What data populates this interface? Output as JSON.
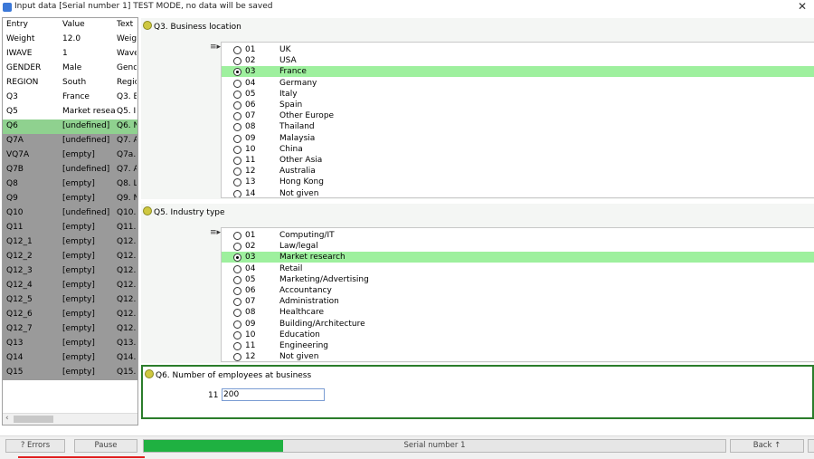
{
  "window": {
    "title": "Input data [Serial number 1] TEST MODE, no data will be saved"
  },
  "grid": {
    "headers": [
      "Entry",
      "Value",
      "Text"
    ],
    "rows": [
      {
        "entry": "Weight",
        "value": "12.0",
        "text": "Weig",
        "state": "answered"
      },
      {
        "entry": "IWAVE",
        "value": "1",
        "text": "Wave",
        "state": "answered"
      },
      {
        "entry": "GENDER",
        "value": "Male",
        "text": "Gend",
        "state": "answered"
      },
      {
        "entry": "REGION",
        "value": "South",
        "text": "Regic",
        "state": "answered"
      },
      {
        "entry": "Q3",
        "value": "France",
        "text": "Q3. B",
        "state": "answered"
      },
      {
        "entry": "Q5",
        "value": "Market resea",
        "text": "Q5. In",
        "state": "answered"
      },
      {
        "entry": "Q6",
        "value": "[undefined]",
        "text": "Q6. N",
        "state": "current"
      },
      {
        "entry": "Q7A",
        "value": "[undefined]",
        "text": "Q7. A",
        "state": "pending"
      },
      {
        "entry": "VQ7A",
        "value": "[empty]",
        "text": "Q7a.",
        "state": "pending"
      },
      {
        "entry": "Q7B",
        "value": "[undefined]",
        "text": "Q7. A",
        "state": "pending"
      },
      {
        "entry": "Q8",
        "value": "[empty]",
        "text": "Q8. L",
        "state": "pending"
      },
      {
        "entry": "Q9",
        "value": "[empty]",
        "text": "Q9. N",
        "state": "pending"
      },
      {
        "entry": "Q10",
        "value": "[undefined]",
        "text": "Q10.",
        "state": "pending"
      },
      {
        "entry": "Q11",
        "value": "[empty]",
        "text": "Q11.",
        "state": "pending"
      },
      {
        "entry": "Q12_1",
        "value": "[empty]",
        "text": "Q12.",
        "state": "pending"
      },
      {
        "entry": "Q12_2",
        "value": "[empty]",
        "text": "Q12.",
        "state": "pending"
      },
      {
        "entry": "Q12_3",
        "value": "[empty]",
        "text": "Q12.",
        "state": "pending"
      },
      {
        "entry": "Q12_4",
        "value": "[empty]",
        "text": "Q12.",
        "state": "pending"
      },
      {
        "entry": "Q12_5",
        "value": "[empty]",
        "text": "Q12.",
        "state": "pending"
      },
      {
        "entry": "Q12_6",
        "value": "[empty]",
        "text": "Q12.",
        "state": "pending"
      },
      {
        "entry": "Q12_7",
        "value": "[empty]",
        "text": "Q12.",
        "state": "pending"
      },
      {
        "entry": "Q13",
        "value": "[empty]",
        "text": "Q13.",
        "state": "pending"
      },
      {
        "entry": "Q14",
        "value": "[empty]",
        "text": "Q14.",
        "state": "pending"
      },
      {
        "entry": "Q15",
        "value": "[empty]",
        "text": "Q15.",
        "state": "pending"
      }
    ]
  },
  "q3": {
    "title": "Q3. Business location",
    "options": [
      {
        "code": "01",
        "label": "UK",
        "selected": false
      },
      {
        "code": "02",
        "label": "USA",
        "selected": false
      },
      {
        "code": "03",
        "label": "France",
        "selected": true
      },
      {
        "code": "04",
        "label": "Germany",
        "selected": false
      },
      {
        "code": "05",
        "label": "Italy",
        "selected": false
      },
      {
        "code": "06",
        "label": "Spain",
        "selected": false
      },
      {
        "code": "07",
        "label": "Other Europe",
        "selected": false
      },
      {
        "code": "08",
        "label": "Thailand",
        "selected": false
      },
      {
        "code": "09",
        "label": "Malaysia",
        "selected": false
      },
      {
        "code": "10",
        "label": "China",
        "selected": false
      },
      {
        "code": "11",
        "label": "Other Asia",
        "selected": false
      },
      {
        "code": "12",
        "label": "Australia",
        "selected": false
      },
      {
        "code": "13",
        "label": "Hong Kong",
        "selected": false
      },
      {
        "code": "14",
        "label": "Not given",
        "selected": false
      }
    ]
  },
  "q5": {
    "title": "Q5. Industry type",
    "options": [
      {
        "code": "01",
        "label": "Computing/IT",
        "selected": false
      },
      {
        "code": "02",
        "label": "Law/legal",
        "selected": false
      },
      {
        "code": "03",
        "label": "Market research",
        "selected": true
      },
      {
        "code": "04",
        "label": "Retail",
        "selected": false
      },
      {
        "code": "05",
        "label": "Marketing/Advertising",
        "selected": false
      },
      {
        "code": "06",
        "label": "Accountancy",
        "selected": false
      },
      {
        "code": "07",
        "label": "Administration",
        "selected": false
      },
      {
        "code": "08",
        "label": "Healthcare",
        "selected": false
      },
      {
        "code": "09",
        "label": "Building/Architecture",
        "selected": false
      },
      {
        "code": "10",
        "label": "Education",
        "selected": false
      },
      {
        "code": "11",
        "label": "Engineering",
        "selected": false
      },
      {
        "code": "12",
        "label": "Not given",
        "selected": false
      }
    ]
  },
  "q6": {
    "title": "Q6. Number of employees at business",
    "prefix": "11",
    "value": "200"
  },
  "bottom": {
    "errors_label": "? Errors",
    "pause_label": "Pause",
    "progress_fraction": 0.24,
    "progress_text": "Serial number 1",
    "back_label": "Back ↑"
  },
  "colors": {
    "current_row": "#8fd18f",
    "pending_row": "#9a9a9a",
    "selected_option": "#9ef09e",
    "progress": "#1fb141",
    "active_border": "#2b7d2b"
  }
}
